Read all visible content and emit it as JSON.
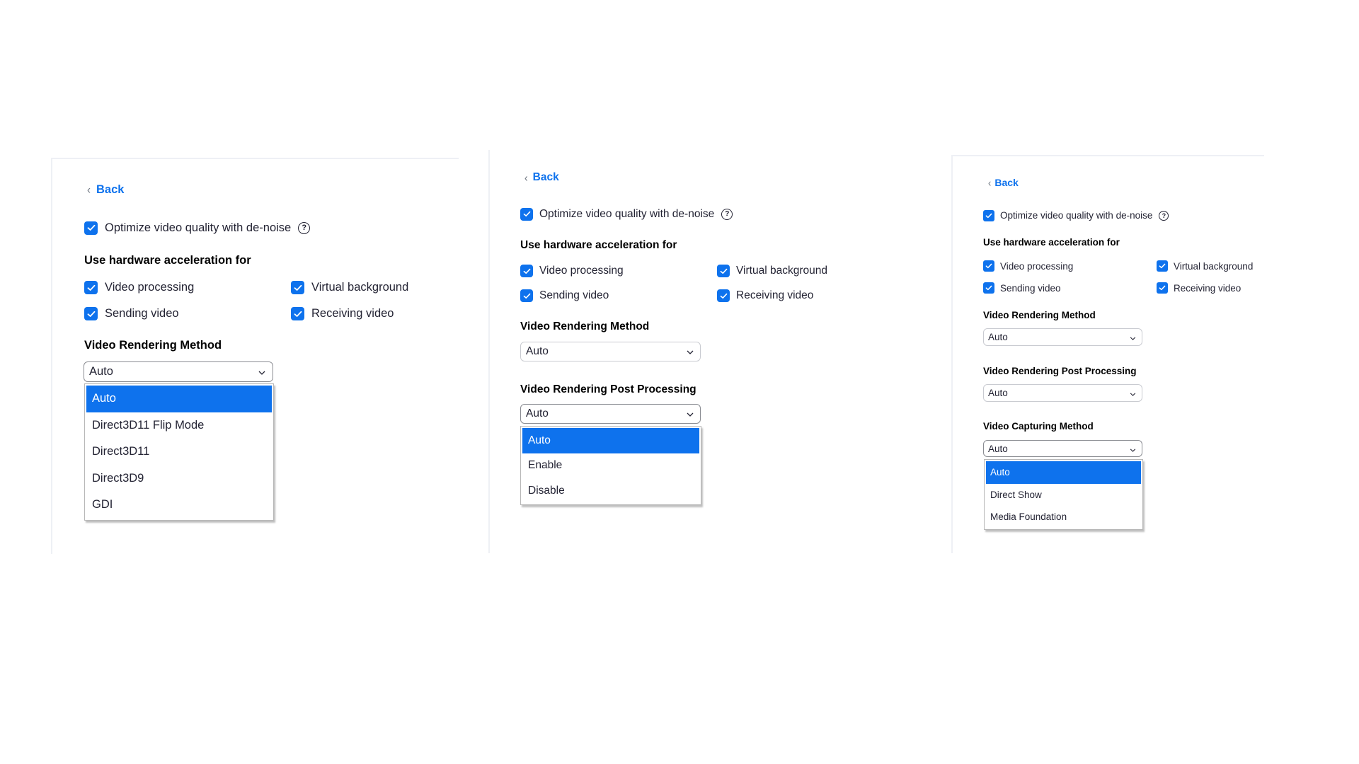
{
  "colors": {
    "accent": "#0e72ed",
    "text": "#232333",
    "heading": "#000000",
    "border": "#eef0f5"
  },
  "panels": [
    {
      "back_label": "Back",
      "denoise": {
        "label": "Optimize video quality with de-noise",
        "checked": true,
        "help_icon": "question-circle-icon"
      },
      "hw_heading": "Use hardware acceleration for",
      "hw_options": [
        {
          "label": "Video processing",
          "checked": true
        },
        {
          "label": "Virtual background",
          "checked": true
        },
        {
          "label": "Sending video",
          "checked": true
        },
        {
          "label": "Receiving video",
          "checked": true
        }
      ],
      "rendering_method": {
        "label": "Video Rendering Method",
        "value": "Auto",
        "open": true,
        "options": [
          "Auto",
          "Direct3D11 Flip Mode",
          "Direct3D11",
          "Direct3D9",
          "GDI"
        ],
        "highlighted": "Auto"
      }
    },
    {
      "back_label": "Back",
      "denoise": {
        "label": "Optimize video quality with de-noise",
        "checked": true,
        "help_icon": "question-circle-icon"
      },
      "hw_heading": "Use hardware acceleration for",
      "hw_options": [
        {
          "label": "Video processing",
          "checked": true
        },
        {
          "label": "Virtual background",
          "checked": true
        },
        {
          "label": "Sending video",
          "checked": true
        },
        {
          "label": "Receiving video",
          "checked": true
        }
      ],
      "rendering_method": {
        "label": "Video Rendering Method",
        "value": "Auto"
      },
      "post_processing": {
        "label": "Video Rendering Post Processing",
        "value": "Auto",
        "open": true,
        "options": [
          "Auto",
          "Enable",
          "Disable"
        ],
        "highlighted": "Auto"
      }
    },
    {
      "back_label": "Back",
      "denoise": {
        "label": "Optimize video quality with de-noise",
        "checked": true,
        "help_icon": "question-circle-icon"
      },
      "hw_heading": "Use hardware acceleration for",
      "hw_options": [
        {
          "label": "Video processing",
          "checked": true
        },
        {
          "label": "Virtual background",
          "checked": true
        },
        {
          "label": "Sending video",
          "checked": true
        },
        {
          "label": "Receiving video",
          "checked": true
        }
      ],
      "rendering_method": {
        "label": "Video Rendering Method",
        "value": "Auto"
      },
      "post_processing": {
        "label": "Video Rendering Post Processing",
        "value": "Auto"
      },
      "capturing_method": {
        "label": "Video Capturing Method",
        "value": "Auto",
        "open": true,
        "options": [
          "Auto",
          "Direct Show",
          "Media Foundation"
        ],
        "highlighted": "Auto"
      }
    }
  ]
}
